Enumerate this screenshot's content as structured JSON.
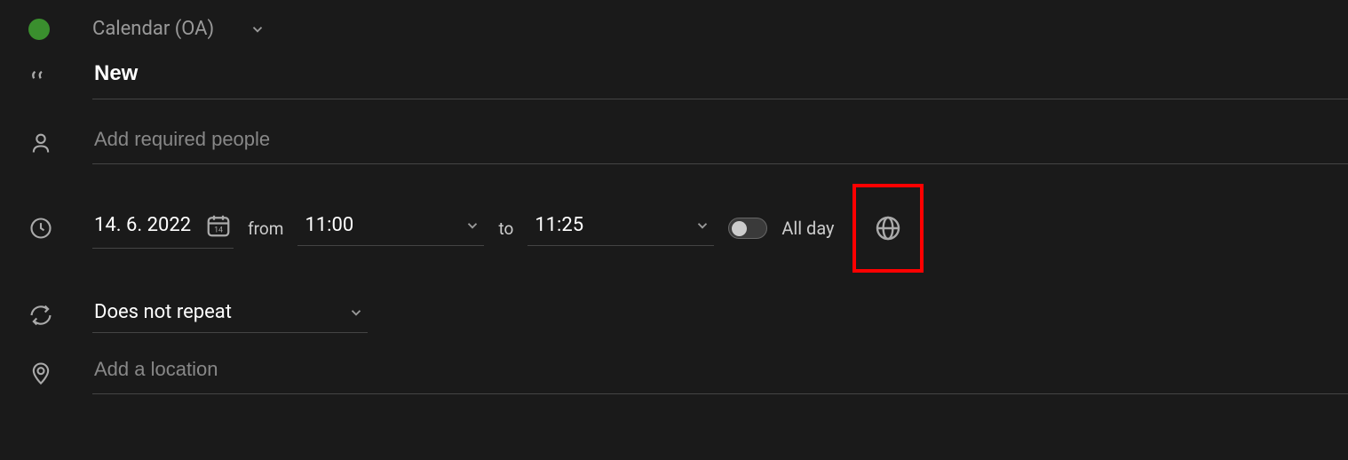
{
  "calendar": {
    "name": "Calendar (OA)",
    "color": "#3a8f2e"
  },
  "event": {
    "title": "New",
    "people_placeholder": "Add required people",
    "date": "14. 6. 2022",
    "calendar_icon_day": "14",
    "from_label": "from",
    "start_time": "11:00",
    "to_label": "to",
    "end_time": "11:25",
    "all_day_label": "All day",
    "all_day": false,
    "repeat": "Does not repeat",
    "location_placeholder": "Add a location"
  }
}
